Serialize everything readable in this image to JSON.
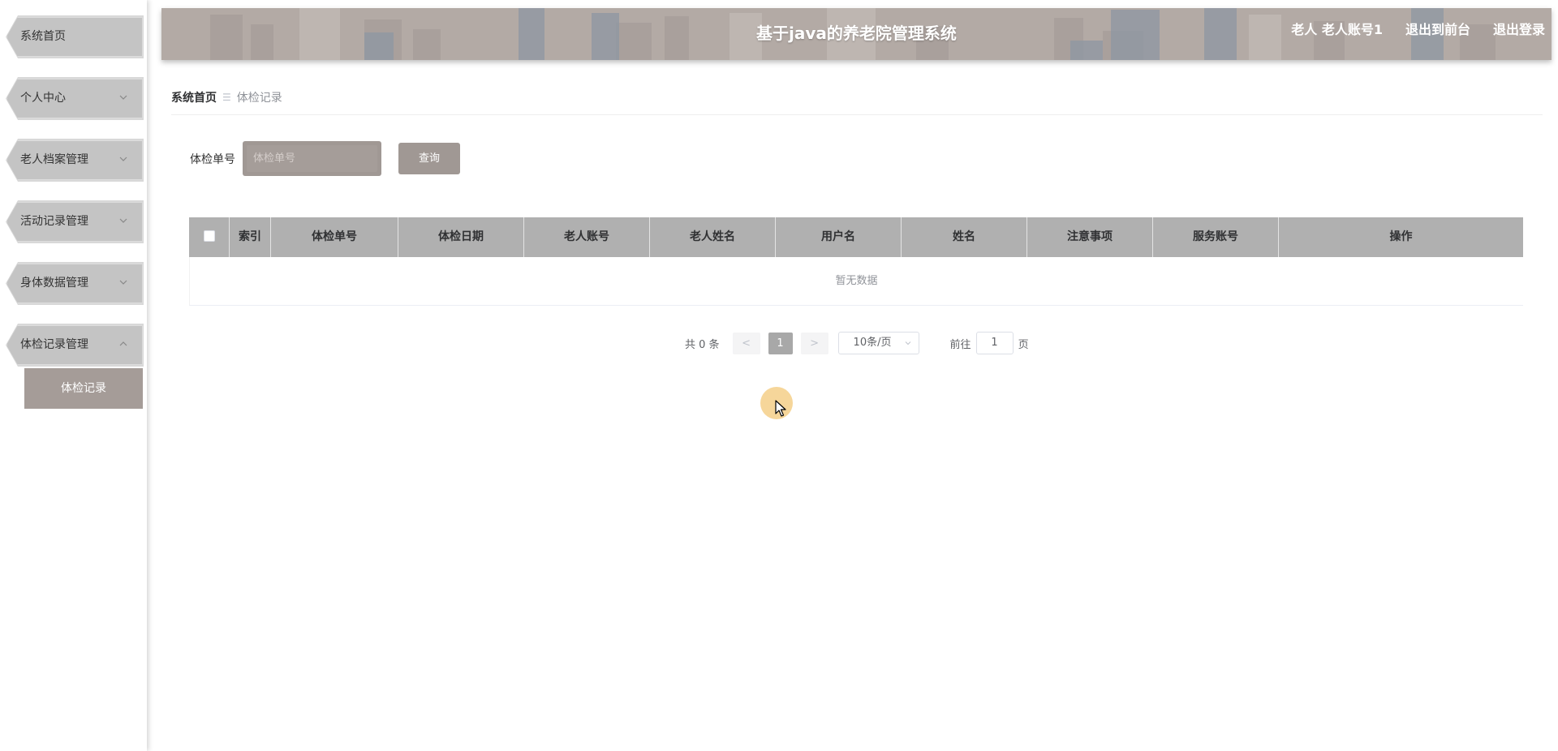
{
  "header": {
    "title": "基于java的养老院管理系统",
    "user_role": "老人",
    "user_account": "老人账号1",
    "back_to_front_label": "退出到前台",
    "logout_label": "退出登录"
  },
  "sidebar": {
    "items": [
      {
        "label": "系统首页",
        "has_chevron": false
      },
      {
        "label": "个人中心",
        "has_chevron": true,
        "expanded": false
      },
      {
        "label": "老人档案管理",
        "has_chevron": true,
        "expanded": false
      },
      {
        "label": "活动记录管理",
        "has_chevron": true,
        "expanded": false
      },
      {
        "label": "身体数据管理",
        "has_chevron": true,
        "expanded": false
      },
      {
        "label": "体检记录管理",
        "has_chevron": true,
        "expanded": true
      }
    ],
    "submenu": {
      "label": "体检记录",
      "active": true
    }
  },
  "breadcrumb": {
    "home": "系统首页",
    "current": "体检记录"
  },
  "search": {
    "label": "体检单号",
    "placeholder": "体检单号",
    "value": "",
    "button_label": "查询"
  },
  "table": {
    "columns": [
      "",
      "索引",
      "体检单号",
      "体检日期",
      "老人账号",
      "老人姓名",
      "用户名",
      "姓名",
      "注意事项",
      "服务账号",
      "操作"
    ],
    "rows": [],
    "empty_text": "暂无数据"
  },
  "pagination": {
    "total_text": "共 0 条",
    "prev_label": "<",
    "next_label": ">",
    "current_page": "1",
    "page_size_label": "10条/页",
    "goto_prefix": "前往",
    "goto_value": "1",
    "goto_suffix": "页"
  },
  "colors": {
    "accent": "#a09894",
    "header_bg": "#b3aaa5",
    "table_header_bg": "#b0b0b0",
    "menu_bg": "#c4c4c4"
  }
}
